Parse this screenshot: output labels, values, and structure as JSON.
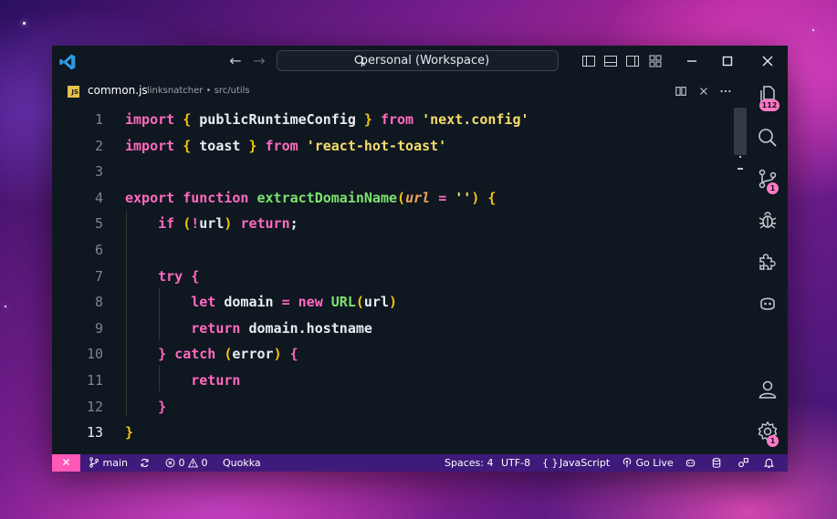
{
  "window": {
    "search_label": "personal (Workspace)"
  },
  "tab": {
    "file_badge": "JS",
    "file_name": "common.js",
    "file_path": "linksnatcher • src/utils"
  },
  "editor": {
    "active_line": 13,
    "lines": [
      {
        "n": "1",
        "tokens": [
          [
            "kw",
            "import"
          ],
          [
            "pu",
            " "
          ],
          [
            "br",
            "{"
          ],
          [
            "id",
            " publicRuntimeConfig "
          ],
          [
            "br",
            "}"
          ],
          [
            "pu",
            " "
          ],
          [
            "kw",
            "from"
          ],
          [
            "pu",
            " "
          ],
          [
            "str",
            "'next.config'"
          ]
        ]
      },
      {
        "n": "2",
        "tokens": [
          [
            "kw",
            "import"
          ],
          [
            "pu",
            " "
          ],
          [
            "br",
            "{"
          ],
          [
            "id",
            " toast "
          ],
          [
            "br",
            "}"
          ],
          [
            "pu",
            " "
          ],
          [
            "kw",
            "from"
          ],
          [
            "pu",
            " "
          ],
          [
            "str",
            "'react-hot-toast'"
          ]
        ]
      },
      {
        "n": "3",
        "tokens": []
      },
      {
        "n": "4",
        "tokens": [
          [
            "kw",
            "export"
          ],
          [
            "pu",
            " "
          ],
          [
            "kw",
            "function"
          ],
          [
            "pu",
            " "
          ],
          [
            "fn",
            "extractDomainName"
          ],
          [
            "br",
            "("
          ],
          [
            "param",
            "url"
          ],
          [
            "pu",
            " "
          ],
          [
            "kw",
            "="
          ],
          [
            "pu",
            " "
          ],
          [
            "str",
            "''"
          ],
          [
            "br",
            ")"
          ],
          [
            "pu",
            " "
          ],
          [
            "br",
            "{"
          ]
        ]
      },
      {
        "n": "5",
        "tokens": [
          [
            "pu",
            "    "
          ],
          [
            "kw",
            "if"
          ],
          [
            "pu",
            " "
          ],
          [
            "br",
            "("
          ],
          [
            "kw",
            "!"
          ],
          [
            "id",
            "url"
          ],
          [
            "br",
            ")"
          ],
          [
            "pu",
            " "
          ],
          [
            "kw",
            "return"
          ],
          [
            "pu",
            ";"
          ]
        ]
      },
      {
        "n": "6",
        "tokens": []
      },
      {
        "n": "7",
        "tokens": [
          [
            "pu",
            "    "
          ],
          [
            "kw",
            "try"
          ],
          [
            "pu",
            " "
          ],
          [
            "kw",
            "{"
          ]
        ]
      },
      {
        "n": "8",
        "tokens": [
          [
            "pu",
            "        "
          ],
          [
            "kw",
            "let"
          ],
          [
            "pu",
            " "
          ],
          [
            "id",
            "domain"
          ],
          [
            "pu",
            " "
          ],
          [
            "kw",
            "="
          ],
          [
            "pu",
            " "
          ],
          [
            "kw",
            "new"
          ],
          [
            "pu",
            " "
          ],
          [
            "cls",
            "URL"
          ],
          [
            "br",
            "("
          ],
          [
            "id",
            "url"
          ],
          [
            "br",
            ")"
          ]
        ]
      },
      {
        "n": "9",
        "tokens": [
          [
            "pu",
            "        "
          ],
          [
            "kw",
            "return"
          ],
          [
            "pu",
            " "
          ],
          [
            "id",
            "domain.hostname"
          ]
        ]
      },
      {
        "n": "10",
        "tokens": [
          [
            "pu",
            "    "
          ],
          [
            "kw",
            "}"
          ],
          [
            "pu",
            " "
          ],
          [
            "kw",
            "catch"
          ],
          [
            "pu",
            " "
          ],
          [
            "br",
            "("
          ],
          [
            "id",
            "error"
          ],
          [
            "br",
            ")"
          ],
          [
            "pu",
            " "
          ],
          [
            "kw",
            "{"
          ]
        ]
      },
      {
        "n": "11",
        "tokens": [
          [
            "pu",
            "        "
          ],
          [
            "kw",
            "return"
          ]
        ]
      },
      {
        "n": "12",
        "tokens": [
          [
            "pu",
            "    "
          ],
          [
            "kw",
            "}"
          ]
        ]
      },
      {
        "n": "13",
        "tokens": [
          [
            "br",
            "}"
          ]
        ]
      }
    ]
  },
  "activity_bar": {
    "explorer_badge": "112",
    "source_control_badge": "1",
    "settings_badge": "1"
  },
  "status_bar": {
    "branch": "main",
    "errors": "0",
    "warnings": "0",
    "quokka": "Quokka",
    "spaces": "Spaces: 4",
    "encoding": "UTF-8",
    "language_braces": "{ }",
    "language": "JavaScript",
    "go_live": "Go Live"
  },
  "colors": {
    "keyword": "#ff6ac1",
    "bracket": "#f5c60c",
    "string": "#f5dd6a",
    "function": "#7fe36f",
    "parameter": "#f0a35a",
    "status_bar": "#3e1a7a",
    "remote_indicator": "#ff58b6",
    "badge": "#ff79c6"
  },
  "icons": {
    "app": "vscode-logo-icon",
    "back": "arrow-left-icon",
    "forward": "arrow-right-icon",
    "activity": [
      "files-icon",
      "search-icon",
      "source-control-icon",
      "debug-icon",
      "extensions-icon",
      "copilot-icon",
      "account-icon",
      "gear-icon"
    ]
  }
}
